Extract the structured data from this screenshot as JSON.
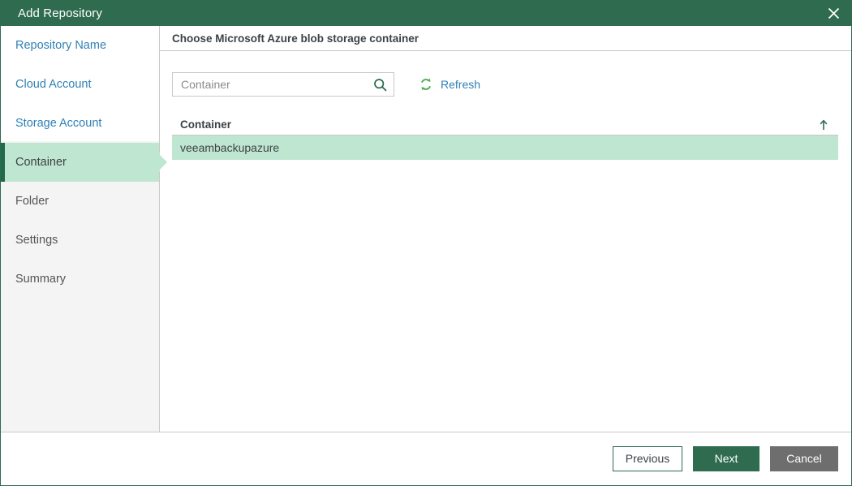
{
  "window": {
    "title": "Add Repository",
    "close_icon": "close-icon",
    "accent_color": "#2e6b4f",
    "selection_color": "#bfe6d0",
    "link_color": "#2f80b5"
  },
  "sidebar": {
    "items": [
      {
        "label": "Repository Name",
        "state": "done"
      },
      {
        "label": "Cloud Account",
        "state": "done"
      },
      {
        "label": "Storage Account",
        "state": "done"
      },
      {
        "label": "Container",
        "state": "active"
      },
      {
        "label": "Folder",
        "state": "pending"
      },
      {
        "label": "Settings",
        "state": "pending"
      },
      {
        "label": "Summary",
        "state": "pending"
      }
    ]
  },
  "content": {
    "header": "Choose Microsoft Azure blob storage container",
    "search": {
      "value": "",
      "placeholder": "Container",
      "icon": "search-icon"
    },
    "refresh": {
      "label": "Refresh",
      "icon": "refresh-icon"
    },
    "table": {
      "columns": [
        "Container"
      ],
      "sort": {
        "column": "Container",
        "direction": "ascending",
        "icon": "arrow-up-icon"
      },
      "rows": [
        {
          "container": "veeambackupazure",
          "selected": true
        }
      ]
    }
  },
  "footer": {
    "previous_label": "Previous",
    "next_label": "Next",
    "cancel_label": "Cancel"
  }
}
